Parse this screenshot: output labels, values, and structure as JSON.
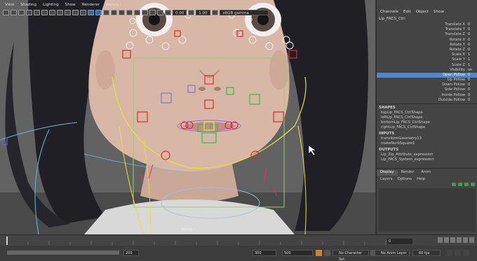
{
  "viewport": {
    "menu": [
      "View",
      "Shading",
      "Lighting",
      "Show",
      "Renderer",
      "Panels"
    ],
    "toolbar": {
      "exposure": "0.00",
      "gamma": "1.00",
      "color_space": "sRGB gamma"
    },
    "camera": "persp"
  },
  "channel_box": {
    "menu": [
      "Channels",
      "Edit",
      "Object",
      "Show"
    ],
    "object_name": "Lip_FACS_Ctrl",
    "attributes": [
      {
        "name": "Translate X",
        "value": "0"
      },
      {
        "name": "Translate Y",
        "value": "0"
      },
      {
        "name": "Translate Z",
        "value": "0"
      },
      {
        "name": "Rotate X",
        "value": "0"
      },
      {
        "name": "Rotate Y",
        "value": "0"
      },
      {
        "name": "Rotate Z",
        "value": "0"
      },
      {
        "name": "Scale X",
        "value": "1"
      },
      {
        "name": "Scale Y",
        "value": "1"
      },
      {
        "name": "Scale Z",
        "value": "1"
      },
      {
        "name": "Visibility",
        "value": "on"
      },
      {
        "name": "Open Pollow",
        "value": "0"
      },
      {
        "name": "Up Pollow",
        "value": "0"
      },
      {
        "name": "Down Pollow",
        "value": "0"
      },
      {
        "name": "Side Pollow",
        "value": "0"
      },
      {
        "name": "Inside Pollow",
        "value": "0"
      },
      {
        "name": "Outside Pollow",
        "value": "0"
      }
    ],
    "selected_attribute": "Open Pollow",
    "shapes_header": "SHAPES",
    "shapes": [
      "topLip_FACS_CtrlShape",
      "leftLip_FACS_CtrlShape",
      "bottomLip_FACS_CtrlShape",
      "rightLip_FACS_CtrlShape"
    ],
    "inputs_header": "INPUTS",
    "inputs": [
      "transformGeometry13",
      "makeNurbSquare1"
    ],
    "outputs_header": "OUTPUTS",
    "outputs": [
      "Lip_Zip_Attribute_expression",
      "Lip_FACS_System_expression"
    ]
  },
  "layer_panel": {
    "tabs": [
      "Display",
      "Render",
      "Anim"
    ],
    "menu": [
      "Layers",
      "Options",
      "Help"
    ]
  },
  "timeline": {
    "current_frame": "0"
  },
  "range_bar": {
    "range_end": "200",
    "anim_end": "300",
    "anim_total": "500",
    "character_set": "No Character Set",
    "anim_layer": "No Anim Layer",
    "fps": "60 fps"
  },
  "colors": {
    "selection": "#5287c6",
    "control_red": "#e02a2a",
    "control_green": "#2fbf4a",
    "control_yellow": "#e8e03a",
    "curve_white": "#e8e8e8"
  }
}
